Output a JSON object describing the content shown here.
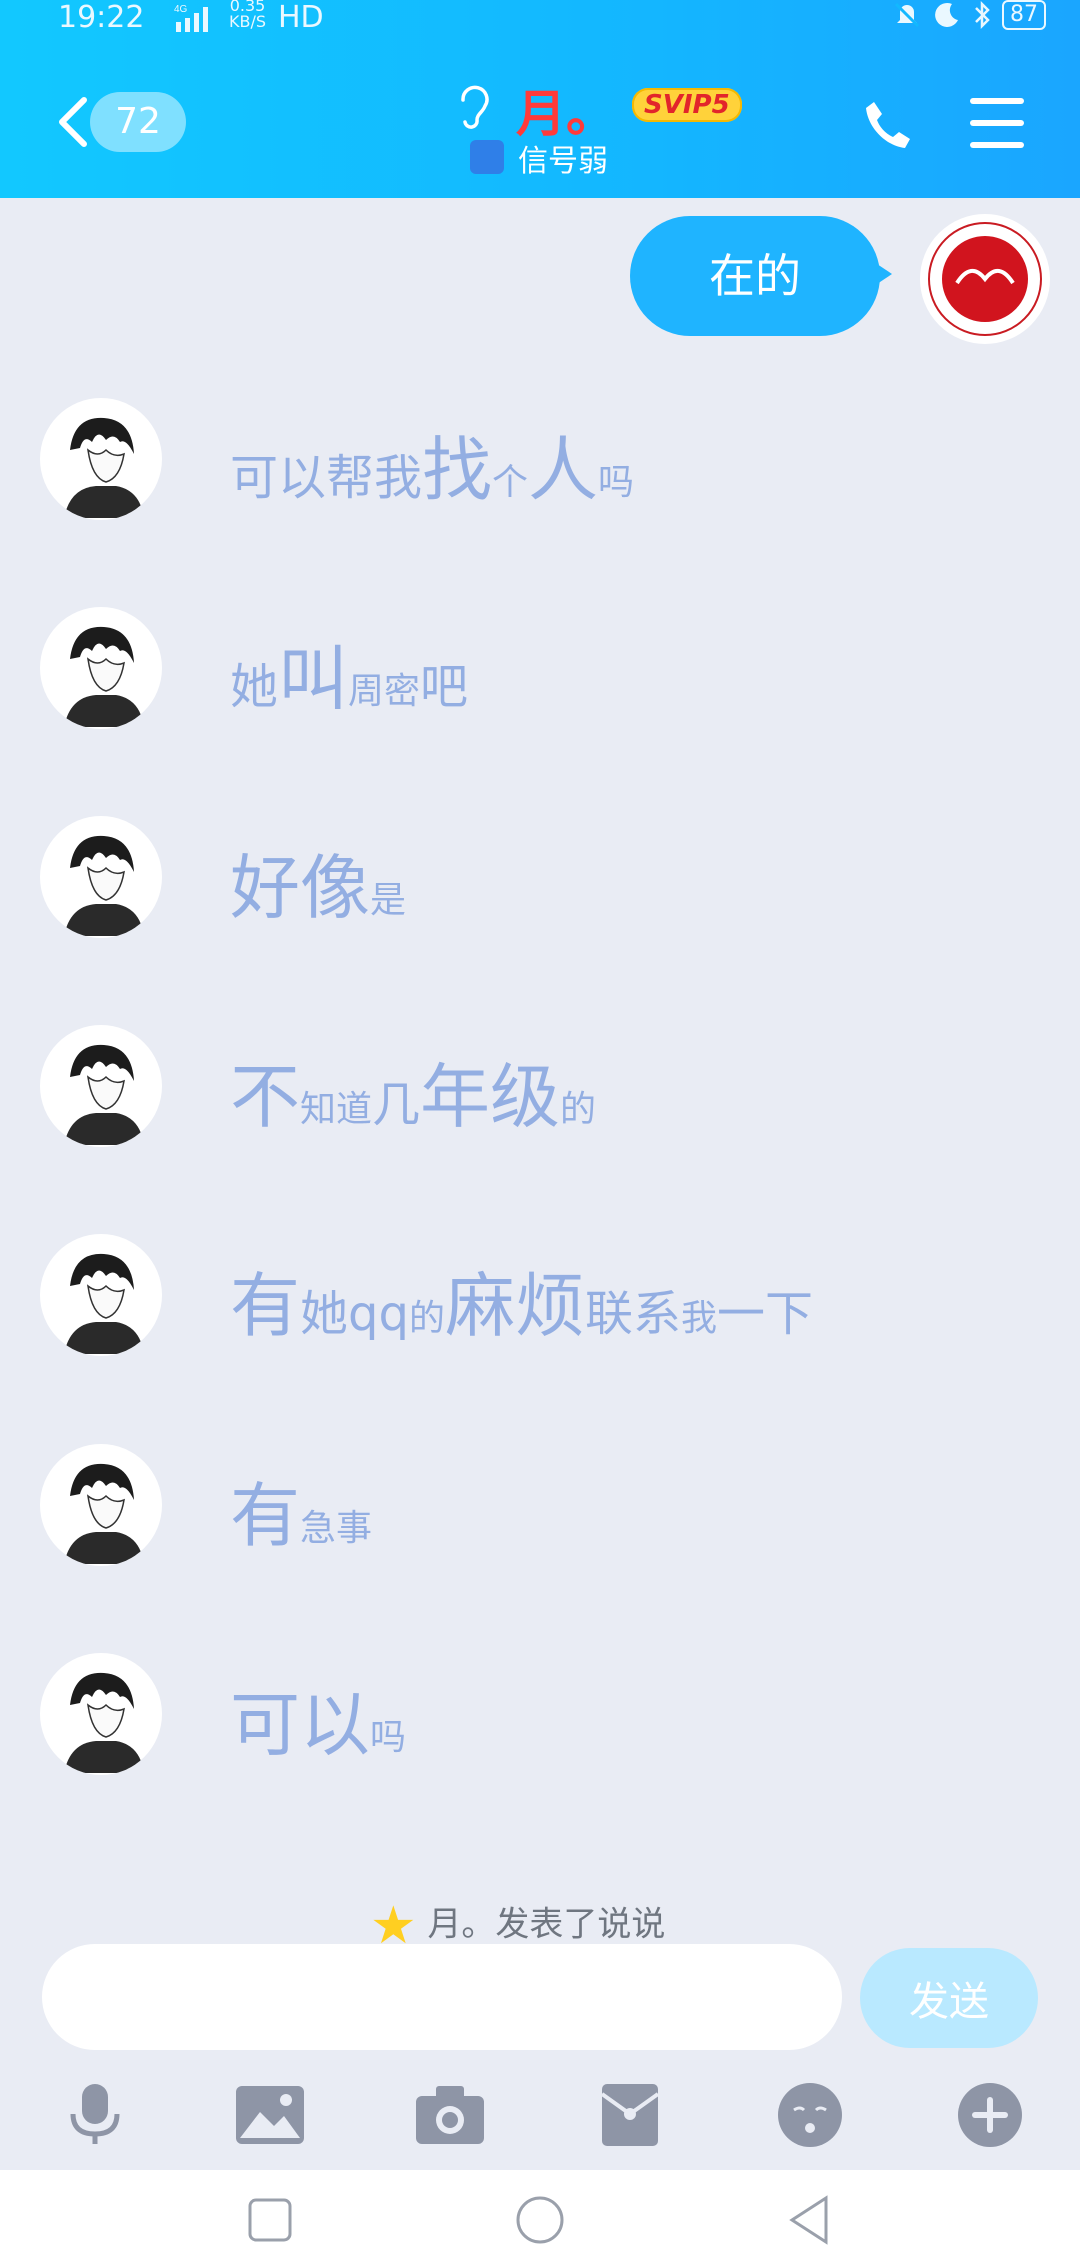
{
  "status_bar": {
    "time": "19:22",
    "network": "4G",
    "speed_value": "0.35",
    "speed_unit": "KB/S",
    "hd": "HD",
    "battery": "87"
  },
  "header": {
    "unread_count": "72",
    "title": "月。",
    "vip_badge": "SVIP5",
    "signal_status": "信号弱"
  },
  "messages": {
    "outgoing": [
      {
        "text": "在的"
      }
    ],
    "incoming": [
      {
        "segments": [
          {
            "t": "可以帮我",
            "s": "mid"
          },
          {
            "t": "找",
            "s": "big"
          },
          {
            "t": "个",
            "s": "small"
          },
          {
            "t": "人",
            "s": "big"
          },
          {
            "t": "吗",
            "s": "small"
          }
        ]
      },
      {
        "segments": [
          {
            "t": "她",
            "s": "mid"
          },
          {
            "t": "叫",
            "s": "big"
          },
          {
            "t": "周密",
            "s": "small"
          },
          {
            "t": "吧",
            "s": "mid"
          }
        ]
      },
      {
        "segments": [
          {
            "t": "好像",
            "s": "big"
          },
          {
            "t": "是",
            "s": "small"
          }
        ]
      },
      {
        "segments": [
          {
            "t": "不",
            "s": "big"
          },
          {
            "t": "知道",
            "s": "small"
          },
          {
            "t": "几",
            "s": "mid"
          },
          {
            "t": "年级",
            "s": "big"
          },
          {
            "t": "的",
            "s": "small"
          }
        ]
      },
      {
        "segments": [
          {
            "t": "有",
            "s": "big"
          },
          {
            "t": "她qq",
            "s": "mid"
          },
          {
            "t": "的",
            "s": "small"
          },
          {
            "t": "麻烦",
            "s": "big"
          },
          {
            "t": "联",
            "s": "mid"
          },
          {
            "t": "系",
            "s": "mid"
          },
          {
            "t": "我",
            "s": "small"
          },
          {
            "t": "一下",
            "s": "mid"
          }
        ]
      },
      {
        "segments": [
          {
            "t": "有",
            "s": "big"
          },
          {
            "t": "急事",
            "s": "small"
          }
        ]
      },
      {
        "segments": [
          {
            "t": "可以",
            "s": "big"
          },
          {
            "t": "吗",
            "s": "small"
          }
        ]
      }
    ],
    "system_note": "月。发表了说说"
  },
  "input_bar": {
    "placeholder": "",
    "send_label": "发送"
  },
  "toolbar_icons": [
    "microphone-icon",
    "image-icon",
    "camera-icon",
    "red-packet-icon",
    "emoji-icon",
    "plus-icon"
  ],
  "colors": {
    "header_start": "#12c8ff",
    "header_end": "#1aa6ff",
    "bubble_out": "#1fb4ff",
    "incoming_text": "#93aee2",
    "background": "#e9ecf4"
  }
}
